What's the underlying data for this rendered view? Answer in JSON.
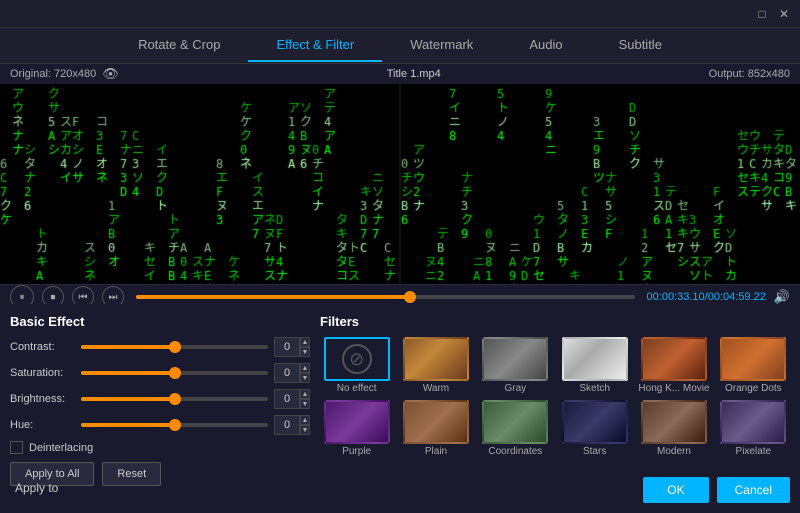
{
  "titleBar": {
    "minimizeLabel": "□",
    "closeLabel": "✕"
  },
  "tabs": [
    {
      "id": "rotate-crop",
      "label": "Rotate & Crop",
      "active": false
    },
    {
      "id": "effect-filter",
      "label": "Effect & Filter",
      "active": true
    },
    {
      "id": "watermark",
      "label": "Watermark",
      "active": false
    },
    {
      "id": "audio",
      "label": "Audio",
      "active": false
    },
    {
      "id": "subtitle",
      "label": "Subtitle",
      "active": false
    }
  ],
  "preview": {
    "originalLabel": "Original: 720x480",
    "outputLabel": "Output: 852x480",
    "fileLabel": "Title 1.mp4",
    "timeDisplay": "00:00:33.10/00:04:59.22"
  },
  "controls": {
    "pauseIcon": "⏸",
    "stopIcon": "⏹",
    "prevIcon": "⏮",
    "nextIcon": "⏭",
    "volumeIcon": "🔊"
  },
  "basicEffect": {
    "title": "Basic Effect",
    "contrast": {
      "label": "Contrast:",
      "value": "0"
    },
    "saturation": {
      "label": "Saturation:",
      "value": "0"
    },
    "brightness": {
      "label": "Brightness:",
      "value": "0"
    },
    "hue": {
      "label": "Hue:",
      "value": "0"
    },
    "deinterlacingLabel": "Deinterlacing",
    "applyToAllLabel": "Apply to All",
    "resetLabel": "Reset"
  },
  "filters": {
    "title": "Filters",
    "items": [
      {
        "id": "no-effect",
        "label": "No effect",
        "selected": true,
        "type": "no-effect"
      },
      {
        "id": "warm",
        "label": "Warm",
        "selected": false,
        "type": "warm"
      },
      {
        "id": "gray",
        "label": "Gray",
        "selected": false,
        "type": "gray"
      },
      {
        "id": "sketch",
        "label": "Sketch",
        "selected": false,
        "type": "sketch"
      },
      {
        "id": "hong-kong",
        "label": "Hong K... Movie",
        "selected": false,
        "type": "hongk"
      },
      {
        "id": "orange-dots",
        "label": "Orange Dots",
        "selected": false,
        "type": "orange-dots"
      },
      {
        "id": "purple",
        "label": "Purple",
        "selected": false,
        "type": "purple"
      },
      {
        "id": "plain",
        "label": "Plain",
        "selected": false,
        "type": "plain"
      },
      {
        "id": "coordinates",
        "label": "Coordinates",
        "selected": false,
        "type": "coordinates"
      },
      {
        "id": "stars",
        "label": "Stars",
        "selected": false,
        "type": "stars"
      },
      {
        "id": "modern",
        "label": "Modern",
        "selected": false,
        "type": "modern"
      },
      {
        "id": "pixelate",
        "label": "Pixelate",
        "selected": false,
        "type": "pixelate"
      }
    ]
  },
  "bottomButtons": {
    "okLabel": "OK",
    "cancelLabel": "Cancel"
  },
  "applyToLabel": "Apply to"
}
